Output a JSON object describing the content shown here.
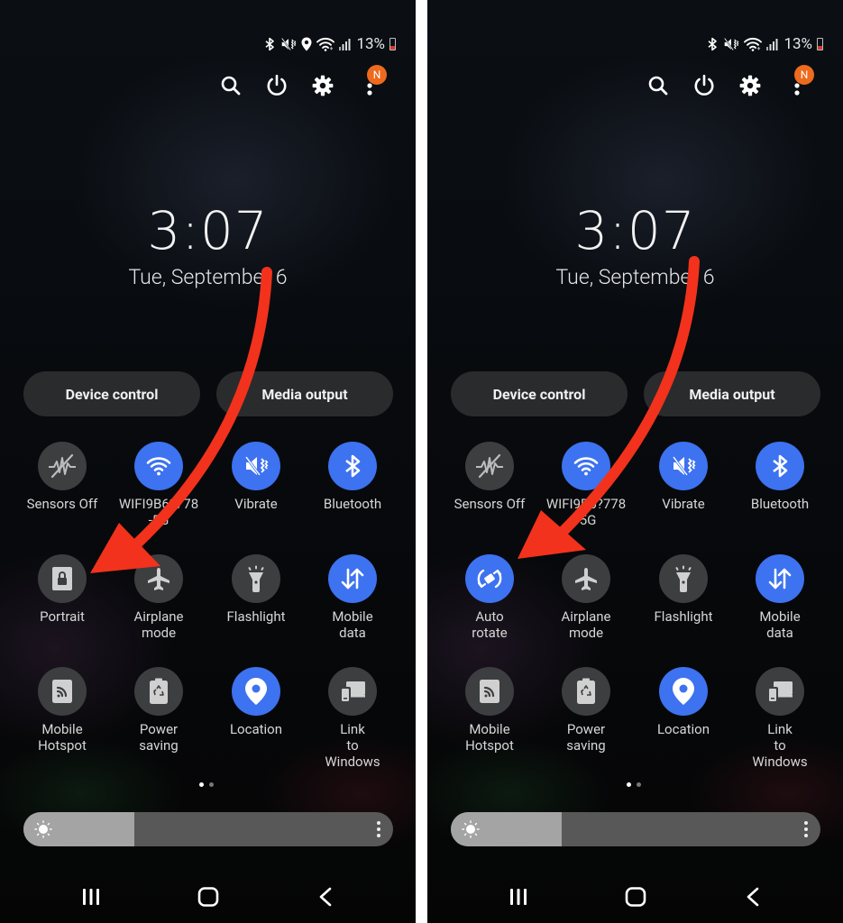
{
  "panels": [
    {
      "id": "left",
      "status_bar": {
        "icons": [
          "bluetooth-icon",
          "vibrate-icon",
          "location-icon",
          "wifi-icon",
          "signal-icon"
        ],
        "battery_percent": "13%"
      },
      "top_actions": {
        "search": "search-icon",
        "power": "power-icon",
        "settings": "gear-icon",
        "more": "more-vertical-icon",
        "notification_badge": "N"
      },
      "clock": {
        "time": "3:07",
        "date": "Tue, September 6"
      },
      "pills": {
        "device_control": "Device control",
        "media_output": "Media output"
      },
      "tiles": [
        {
          "label": "Sensors Off",
          "icon": "sensors-off-icon",
          "active": false
        },
        {
          "label": "WIFI9B6?778-5G",
          "icon": "wifi-icon",
          "active": true
        },
        {
          "label": "Vibrate",
          "icon": "vibrate-icon",
          "active": true
        },
        {
          "label": "Bluetooth",
          "icon": "bluetooth-icon",
          "active": true
        },
        {
          "label": "Portrait",
          "icon": "portrait-lock-icon",
          "active": false
        },
        {
          "label": "Airplane mode",
          "icon": "airplane-icon",
          "active": false
        },
        {
          "label": "Flashlight",
          "icon": "flashlight-icon",
          "active": false
        },
        {
          "label": "Mobile data",
          "icon": "mobile-data-icon",
          "active": true
        },
        {
          "label": "Mobile Hotspot",
          "icon": "hotspot-icon",
          "active": false
        },
        {
          "label": "Power saving",
          "icon": "power-saving-icon",
          "active": false
        },
        {
          "label": "Location",
          "icon": "location-icon",
          "active": true
        },
        {
          "label": "Link to Windows",
          "icon": "link-to-windows-icon",
          "active": false
        }
      ],
      "pager": {
        "pages": 2,
        "current": 1
      },
      "brightness": {
        "level_percent": 30
      },
      "nav": {
        "recents": "recents-icon",
        "home": "home-icon",
        "back": "back-icon"
      }
    },
    {
      "id": "right",
      "status_bar": {
        "icons": [
          "bluetooth-icon",
          "vibrate-icon",
          "wifi-icon",
          "signal-icon"
        ],
        "battery_percent": "13%"
      },
      "top_actions": {
        "search": "search-icon",
        "power": "power-icon",
        "settings": "gear-icon",
        "more": "more-vertical-icon",
        "notification_badge": "N"
      },
      "clock": {
        "time": "3:07",
        "date": "Tue, September 6"
      },
      "pills": {
        "device_control": "Device control",
        "media_output": "Media output"
      },
      "tiles": [
        {
          "label": "Sensors Off",
          "icon": "sensors-off-icon",
          "active": false
        },
        {
          "label": "WIFI9B6?778-5G",
          "icon": "wifi-icon",
          "active": true
        },
        {
          "label": "Vibrate",
          "icon": "vibrate-icon",
          "active": true
        },
        {
          "label": "Bluetooth",
          "icon": "bluetooth-icon",
          "active": true
        },
        {
          "label": "Auto rotate",
          "icon": "auto-rotate-icon",
          "active": true
        },
        {
          "label": "Airplane mode",
          "icon": "airplane-icon",
          "active": false
        },
        {
          "label": "Flashlight",
          "icon": "flashlight-icon",
          "active": false
        },
        {
          "label": "Mobile data",
          "icon": "mobile-data-icon",
          "active": true
        },
        {
          "label": "Mobile Hotspot",
          "icon": "hotspot-icon",
          "active": false
        },
        {
          "label": "Power saving",
          "icon": "power-saving-icon",
          "active": false
        },
        {
          "label": "Location",
          "icon": "location-icon",
          "active": true
        },
        {
          "label": "Link to Windows",
          "icon": "link-to-windows-icon",
          "active": false
        }
      ],
      "pager": {
        "pages": 2,
        "current": 1
      },
      "brightness": {
        "level_percent": 30
      },
      "nav": {
        "recents": "recents-icon",
        "home": "home-icon",
        "back": "back-icon"
      }
    }
  ],
  "annotation": {
    "arrow_color": "#f2321c"
  },
  "colors": {
    "tile_on": "#3d72f0",
    "tile_off": "#3d3e40",
    "badge": "#ee6a1e"
  }
}
